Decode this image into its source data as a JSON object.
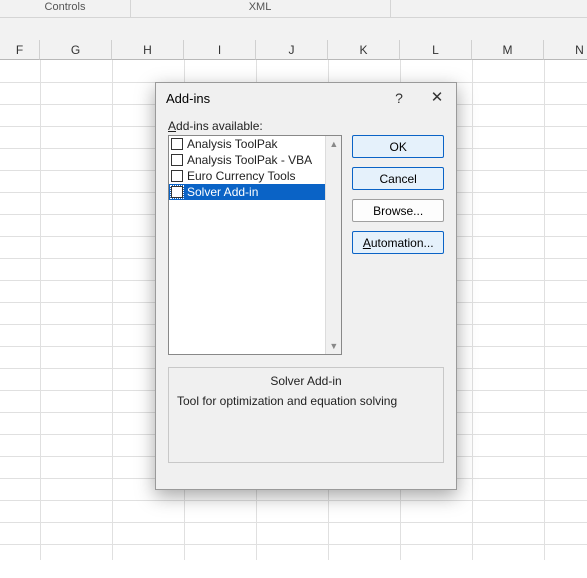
{
  "ribbon": {
    "groups": {
      "controls": "Controls",
      "xml": "XML"
    }
  },
  "columns": [
    "F",
    "G",
    "H",
    "I",
    "J",
    "K",
    "L",
    "M",
    "N"
  ],
  "dialog": {
    "title": "Add-ins",
    "help_glyph": "?",
    "close_glyph": "✕",
    "available_label_pre": "",
    "available_label_underline": "A",
    "available_label_post": "dd-ins available:",
    "items": [
      {
        "label": "Analysis ToolPak",
        "checked": false,
        "selected": false
      },
      {
        "label": "Analysis ToolPak - VBA",
        "checked": false,
        "selected": false
      },
      {
        "label": "Euro Currency Tools",
        "checked": false,
        "selected": false
      },
      {
        "label": "Solver Add-in",
        "checked": false,
        "selected": true
      }
    ],
    "buttons": {
      "ok": "OK",
      "cancel": "Cancel",
      "browse": "Browse...",
      "automation_underline": "A",
      "automation_rest": "utomation..."
    },
    "description": {
      "name": "Solver Add-in",
      "text": "Tool for optimization and equation solving"
    }
  }
}
